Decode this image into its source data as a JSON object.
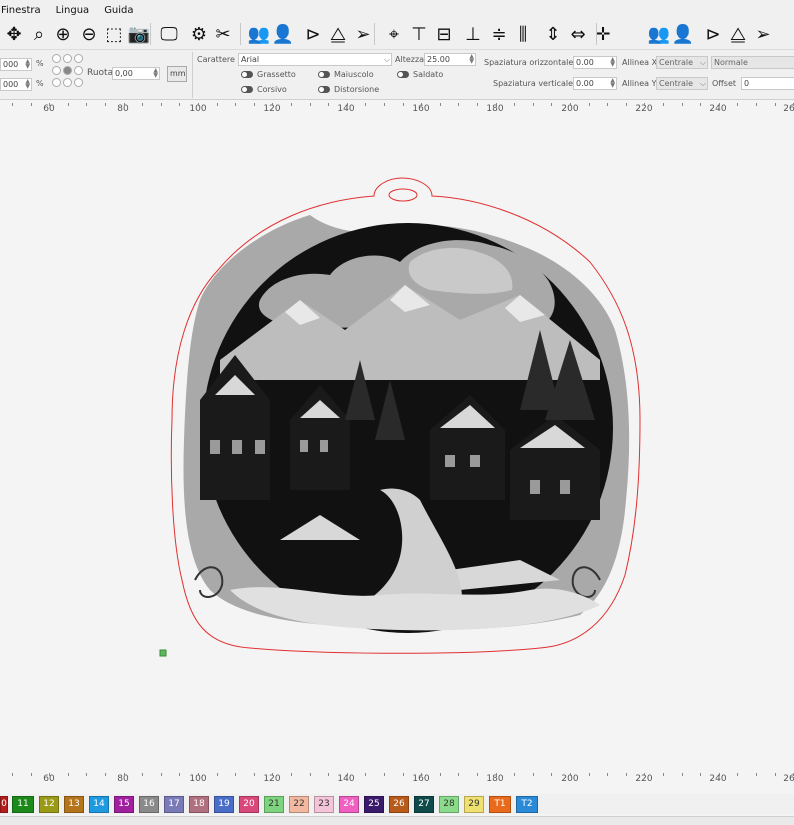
{
  "menu": [
    "Finestra",
    "Lingua",
    "Guida"
  ],
  "toolbar": {
    "icons": [
      {
        "name": "move-icon",
        "glyph": "✥"
      },
      {
        "name": "zoom-fit-icon",
        "glyph": "⌕"
      },
      {
        "name": "zoom-in-icon",
        "glyph": "⊕"
      },
      {
        "name": "zoom-out-icon",
        "glyph": "⊖"
      },
      {
        "name": "select-frame-icon",
        "glyph": "⬚"
      },
      {
        "name": "camera-icon",
        "glyph": "📷"
      },
      {
        "name": "monitor-icon",
        "glyph": "🖵"
      },
      {
        "name": "settings-gears-icon",
        "glyph": "⚙"
      },
      {
        "name": "tools-icon",
        "glyph": "✂"
      },
      {
        "name": "users-group-icon",
        "glyph": "👥"
      },
      {
        "name": "user-icon",
        "glyph": "👤"
      },
      {
        "name": "mirror-horizontal-icon",
        "glyph": "⊳"
      },
      {
        "name": "mirror-vertical-icon",
        "glyph": "⧋"
      },
      {
        "name": "send-icon",
        "glyph": "➢"
      },
      {
        "name": "target-icon",
        "glyph": "⌖"
      },
      {
        "name": "align-top-icon",
        "glyph": "⊤"
      },
      {
        "name": "align-middle-icon",
        "glyph": "⊟"
      },
      {
        "name": "align-bottom-icon",
        "glyph": "⊥"
      },
      {
        "name": "distribute-vertical-icon",
        "glyph": "≑"
      },
      {
        "name": "distribute-horizontal-icon",
        "glyph": "⫼"
      },
      {
        "name": "space-vertical-icon",
        "glyph": "⇕"
      },
      {
        "name": "space-horizontal-icon",
        "glyph": "⇔"
      },
      {
        "name": "center-cross-icon",
        "glyph": "✛"
      },
      {
        "name": "users-group-2-icon",
        "glyph": "👥"
      },
      {
        "name": "user-2-icon",
        "glyph": "👤"
      },
      {
        "name": "mirror-horizontal-2-icon",
        "glyph": "⊳"
      },
      {
        "name": "mirror-vertical-2-icon",
        "glyph": "⧋"
      },
      {
        "name": "send-2-icon",
        "glyph": "➢"
      },
      {
        "name": "target-2-icon",
        "glyph": "⌖"
      },
      {
        "name": "align-left-icon",
        "glyph": "⊢"
      },
      {
        "name": "align-extra-icon",
        "glyph": "▕"
      }
    ]
  },
  "props": {
    "w_value": "000",
    "h_value": "000",
    "percent": "%",
    "ruota_label": "Ruota",
    "ruota_value": "0,00",
    "mm_label": "mm",
    "carattere_label": "Carattere",
    "font_value": "Arial",
    "altezza_label": "Altezza",
    "altezza_value": "25.00",
    "grassetto": "Grassetto",
    "maiuscolo": "Maiuscolo",
    "saldato": "Saldato",
    "corsivo": "Corsivo",
    "distorsione": "Distorsione",
    "sp_orizz_label": "Spaziatura orizzontale",
    "sp_orizz_value": "0.00",
    "sp_vert_label": "Spaziatura verticale",
    "sp_vert_value": "0.00",
    "allinea_x_label": "Allinea X",
    "allinea_x_value": "Centrale",
    "allinea_y_label": "Allinea Y",
    "allinea_y_value": "Centrale",
    "normale_value": "Normale",
    "offset_label": "Offset",
    "offset_value": "0"
  },
  "ruler_labels": [
    "60",
    "80",
    "100",
    "120",
    "140",
    "160",
    "180",
    "200",
    "220",
    "240",
    "26"
  ],
  "palette": [
    {
      "label": "0",
      "color": "#b71c1c"
    },
    {
      "label": "11",
      "color": "#1b8a1b"
    },
    {
      "label": "12",
      "color": "#9a9a16"
    },
    {
      "label": "13",
      "color": "#b3741a"
    },
    {
      "label": "14",
      "color": "#1e9be0"
    },
    {
      "label": "15",
      "color": "#a020a0"
    },
    {
      "label": "16",
      "color": "#8a8a8a"
    },
    {
      "label": "17",
      "color": "#7a7ab8"
    },
    {
      "label": "18",
      "color": "#b07080"
    },
    {
      "label": "19",
      "color": "#4a6ec8"
    },
    {
      "label": "20",
      "color": "#d8487a"
    },
    {
      "label": "21",
      "color": "#7ed47e"
    },
    {
      "label": "22",
      "color": "#f2b8a0"
    },
    {
      "label": "23",
      "color": "#f4c4d8"
    },
    {
      "label": "24",
      "color": "#f060c0"
    },
    {
      "label": "25",
      "color": "#3a1a6a"
    },
    {
      "label": "26",
      "color": "#b85a1a"
    },
    {
      "label": "27",
      "color": "#0e4a4a"
    },
    {
      "label": "28",
      "color": "#8adc8a"
    },
    {
      "label": "29",
      "color": "#f0e070"
    },
    {
      "label": "T1",
      "color": "#e86a1a"
    },
    {
      "label": "T2",
      "color": "#2a8ad8"
    }
  ],
  "colors": {
    "cut_line": "#e03030",
    "node_marker": "#5cb85c"
  }
}
